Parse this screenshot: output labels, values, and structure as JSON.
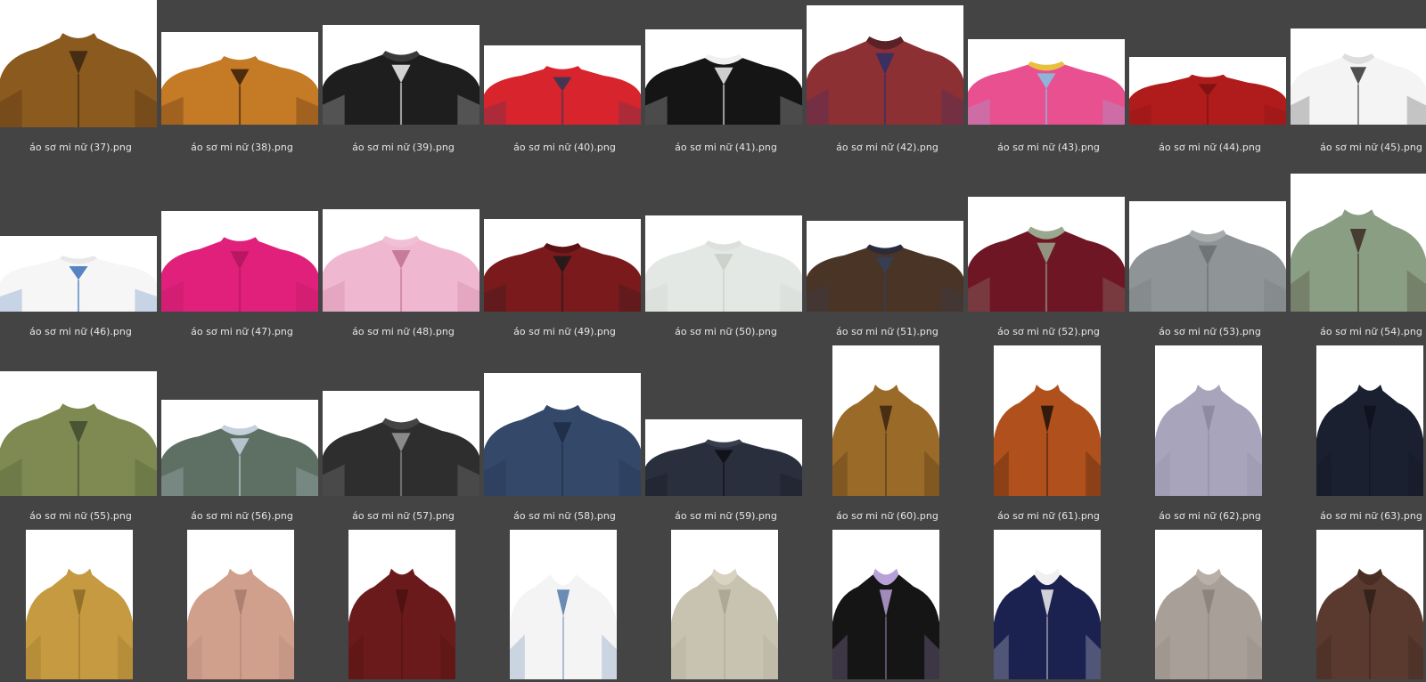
{
  "window": {
    "background": "#444444",
    "label_color": "#e6e6e6"
  },
  "files": [
    {
      "name": "áo sơ mi nữ (37).png",
      "icon": "leopard-print-top-thumbnail",
      "color": "#8b5a1e",
      "accent": "#3a2410",
      "collar": "#8b5a1e"
    },
    {
      "name": "áo sơ mi nữ (38).png",
      "icon": "tiger-print-top-thumbnail",
      "color": "#c57a26",
      "accent": "#3a1d0a",
      "collar": "#c57a26"
    },
    {
      "name": "áo sơ mi nữ (39).png",
      "icon": "black-blazer-turtleneck-thumbnail",
      "color": "#1e1e1e",
      "accent": "#f2f2f2",
      "collar": "#3a3a3a"
    },
    {
      "name": "áo sơ mi nữ (40).png",
      "icon": "red-polo-shirt-thumbnail",
      "color": "#d8242c",
      "accent": "#2a3a5a",
      "collar": "#d8242c"
    },
    {
      "name": "áo sơ mi nữ (41).png",
      "icon": "black-sailor-jacket-thumbnail",
      "color": "#151515",
      "accent": "#f0f0f0",
      "collar": "#f0f0f0"
    },
    {
      "name": "áo sơ mi nữ (42).png",
      "icon": "red-tweed-coat-thumbnail",
      "color": "#8c3034",
      "accent": "#2a2f6a",
      "collar": "#5a2226"
    },
    {
      "name": "áo sơ mi nữ (43).png",
      "icon": "striped-sweater-thumbnail",
      "color": "#e8508f",
      "accent": "#7fc5e8",
      "collar": "#e8c040"
    },
    {
      "name": "áo sơ mi nữ (44).png",
      "icon": "red-shirt-thumbnail",
      "color": "#b01c1c",
      "accent": "#7a1010",
      "collar": "#b01c1c"
    },
    {
      "name": "áo sơ mi nữ (45).png",
      "icon": "teddy-bear-tee-thumbnail",
      "color": "#f4f4f4",
      "accent": "#333333",
      "collar": "#dddddd"
    },
    {
      "name": "áo sơ mi nữ (46).png",
      "icon": "wave-print-tee-thumbnail",
      "color": "#f6f6f6",
      "accent": "#3a70b8",
      "collar": "#e8e8e8"
    },
    {
      "name": "áo sơ mi nữ (47).png",
      "icon": "pink-cardigan-thumbnail",
      "color": "#e0207a",
      "accent": "#b01660",
      "collar": "#e0207a"
    },
    {
      "name": "áo sơ mi nữ (48).png",
      "icon": "pink-plaid-shirt-thumbnail",
      "color": "#f0b8d0",
      "accent": "#c07090",
      "collar": "#f0c0d6"
    },
    {
      "name": "áo sơ mi nữ (49).png",
      "icon": "dark-red-blazer-thumbnail",
      "color": "#7a1a1c",
      "accent": "#1a1a1a",
      "collar": "#5a1214"
    },
    {
      "name": "áo sơ mi nữ (50).png",
      "icon": "white-knit-sweater-thumbnail",
      "color": "#e4e8e4",
      "accent": "#c8ccc8",
      "collar": "#dde1dd"
    },
    {
      "name": "áo sơ mi nữ (51).png",
      "icon": "fur-jacket-thumbnail",
      "color": "#4a3426",
      "accent": "#34405a",
      "collar": "#2b2b3b"
    },
    {
      "name": "áo sơ mi nữ (52).png",
      "icon": "maroon-cardigan-thumbnail",
      "color": "#6e1624",
      "accent": "#9aa890",
      "collar": "#9aa890"
    },
    {
      "name": "áo sơ mi nữ (53).png",
      "icon": "grey-plaid-shirt-thumbnail",
      "color": "#8f9596",
      "accent": "#6a7072",
      "collar": "#a6abac"
    },
    {
      "name": "áo sơ mi nữ (54).png",
      "icon": "green-turtleneck-thumbnail",
      "color": "#8a9e84",
      "accent": "#3a2a22",
      "collar": "#8a9e84"
    },
    {
      "name": "áo sơ mi nữ (55).png",
      "icon": "olive-zip-sweater-thumbnail",
      "color": "#7f8a52",
      "accent": "#3e4a2e",
      "collar": "#7f8a52"
    },
    {
      "name": "áo sơ mi nữ (56).png",
      "icon": "grey-green-sweater-thumbnail",
      "color": "#5e7064",
      "accent": "#c5d0de",
      "collar": "#c5d0de"
    },
    {
      "name": "áo sơ mi nữ (57).png",
      "icon": "black-white-knit-thumbnail",
      "color": "#2e2e2e",
      "accent": "#9a9a9a",
      "collar": "#444444"
    },
    {
      "name": "áo sơ mi nữ (58).png",
      "icon": "denim-jacket-thumbnail",
      "color": "#34496a",
      "accent": "#1e2c44",
      "collar": "#34496a"
    },
    {
      "name": "áo sơ mi nữ (59).png",
      "icon": "navy-jacket-thumbnail",
      "color": "#2a2f3e",
      "accent": "#0e0e14",
      "collar": "#3a3f4e"
    },
    {
      "name": "áo sơ mi nữ (60).png",
      "icon": "leopard-turtleneck-thumbnail",
      "color": "#9a6a28",
      "accent": "#3a2410",
      "collar": "#9a6a28"
    },
    {
      "name": "áo sơ mi nữ (61).png",
      "icon": "leopard-print-blouse-thumbnail",
      "color": "#b0501c",
      "accent": "#1e1008",
      "collar": "#b0501c"
    },
    {
      "name": "áo sơ mi nữ (62).png",
      "icon": "lavender-knit-thumbnail",
      "color": "#a8a4bc",
      "accent": "#8a86a0",
      "collar": "#a8a4bc"
    },
    {
      "name": "áo sơ mi nữ (63).png",
      "icon": "navy-turtleneck-thumbnail",
      "color": "#1a2030",
      "accent": "#0e121c",
      "collar": "#1a2030"
    },
    {
      "name": "",
      "icon": "mustard-turtleneck-thumbnail",
      "color": "#c59a40",
      "accent": "#8a6a28",
      "collar": "#c59a40"
    },
    {
      "name": "",
      "icon": "peach-knit-turtleneck-thumbnail",
      "color": "#d0a08c",
      "accent": "#a87a6a",
      "collar": "#d0a08c"
    },
    {
      "name": "",
      "icon": "maroon-turtleneck-thumbnail",
      "color": "#6a1a1a",
      "accent": "#4a1010",
      "collar": "#6a1a1a"
    },
    {
      "name": "",
      "icon": "denim-vest-white-shirt-thumbnail",
      "color": "#f4f4f4",
      "accent": "#5078a8",
      "collar": "#ffffff"
    },
    {
      "name": "",
      "icon": "beige-jacket-thumbnail",
      "color": "#c8c2b0",
      "accent": "#a8a290",
      "collar": "#d8d2c0"
    },
    {
      "name": "",
      "icon": "black-blazer-lilac-shirt-thumbnail",
      "color": "#151515",
      "accent": "#b8a0d8",
      "collar": "#b8a0d8"
    },
    {
      "name": "",
      "icon": "navy-striped-jacket-thumbnail",
      "color": "#1c2250",
      "accent": "#f0f0f0",
      "collar": "#f0f0f0"
    },
    {
      "name": "",
      "icon": "taupe-blazer-thumbnail",
      "color": "#a8a098",
      "accent": "#888078",
      "collar": "#b8b0a8"
    },
    {
      "name": "",
      "icon": "brown-patchwork-jacket-thumbnail",
      "color": "#5a3a2e",
      "accent": "#2e1e18",
      "collar": "#4a2e24"
    }
  ]
}
